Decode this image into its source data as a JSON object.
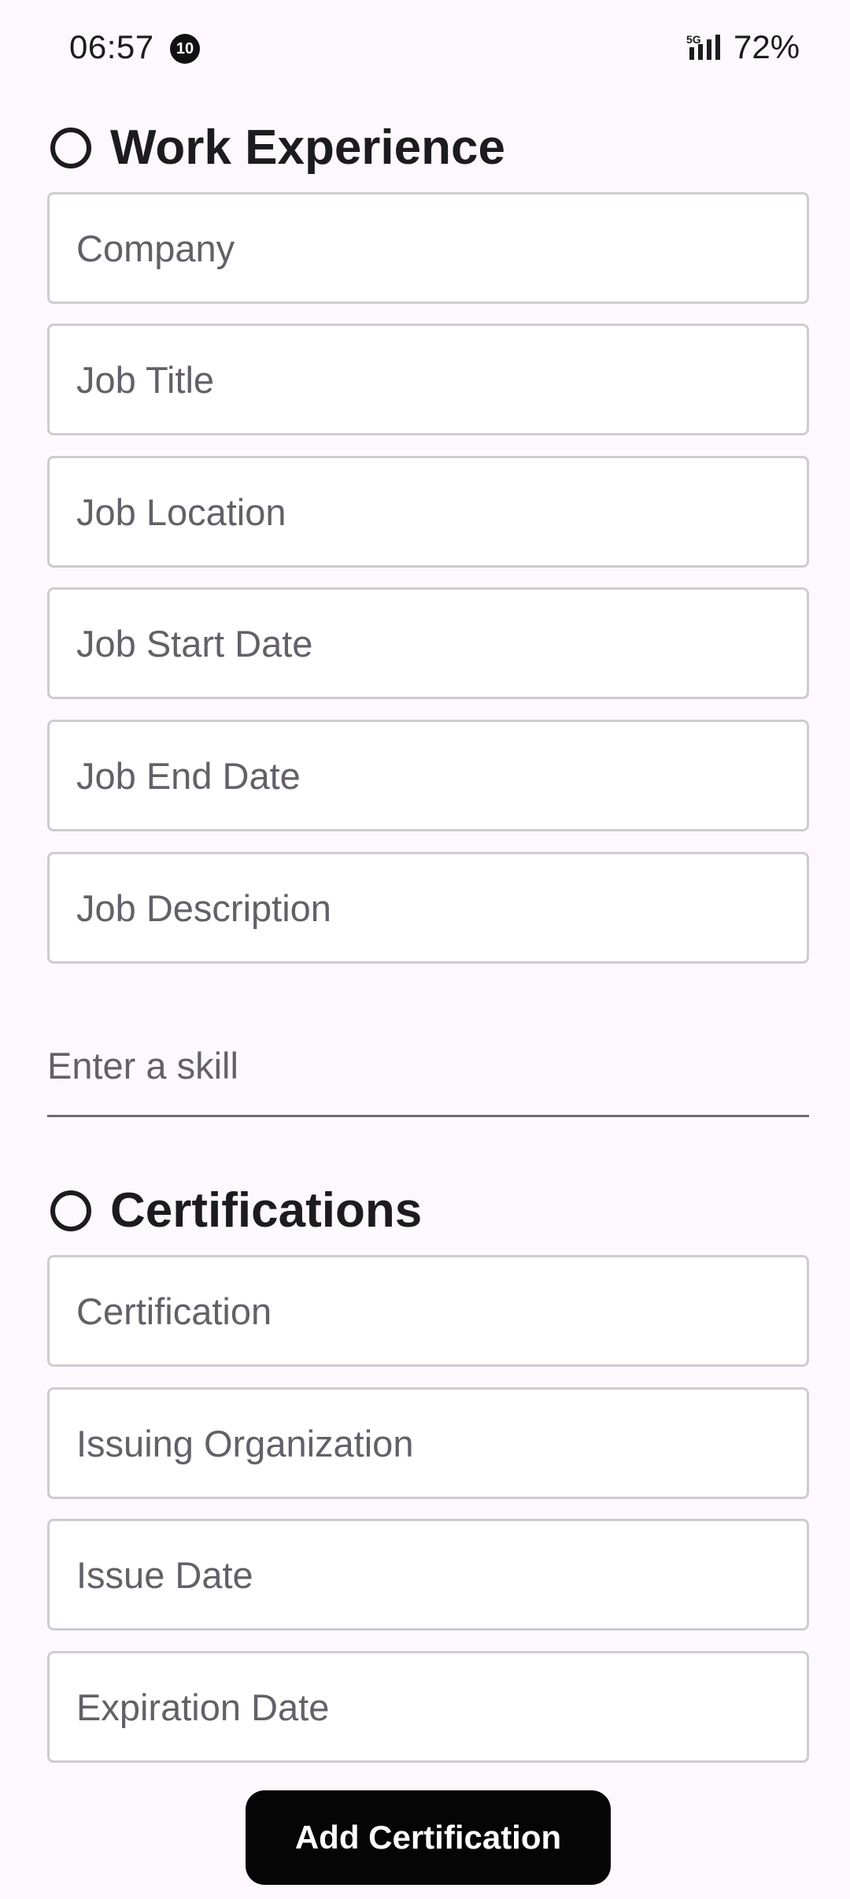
{
  "status_bar": {
    "time": "06:57",
    "notification_count": "10",
    "network": "5G",
    "battery": "72%"
  },
  "work_experience": {
    "title": "Work Experience",
    "fields": {
      "company": "Company",
      "job_title": "Job Title",
      "job_location": "Job Location",
      "job_start_date": "Job Start Date",
      "job_end_date": "Job End Date",
      "job_description": "Job Description"
    }
  },
  "skills": {
    "placeholder": "Enter a skill"
  },
  "certifications": {
    "title": "Certifications",
    "fields": {
      "certification": "Certification",
      "issuing_organization": "Issuing Organization",
      "issue_date": "Issue Date",
      "expiration_date": "Expiration Date"
    },
    "add_button_label": "Add Certification"
  }
}
